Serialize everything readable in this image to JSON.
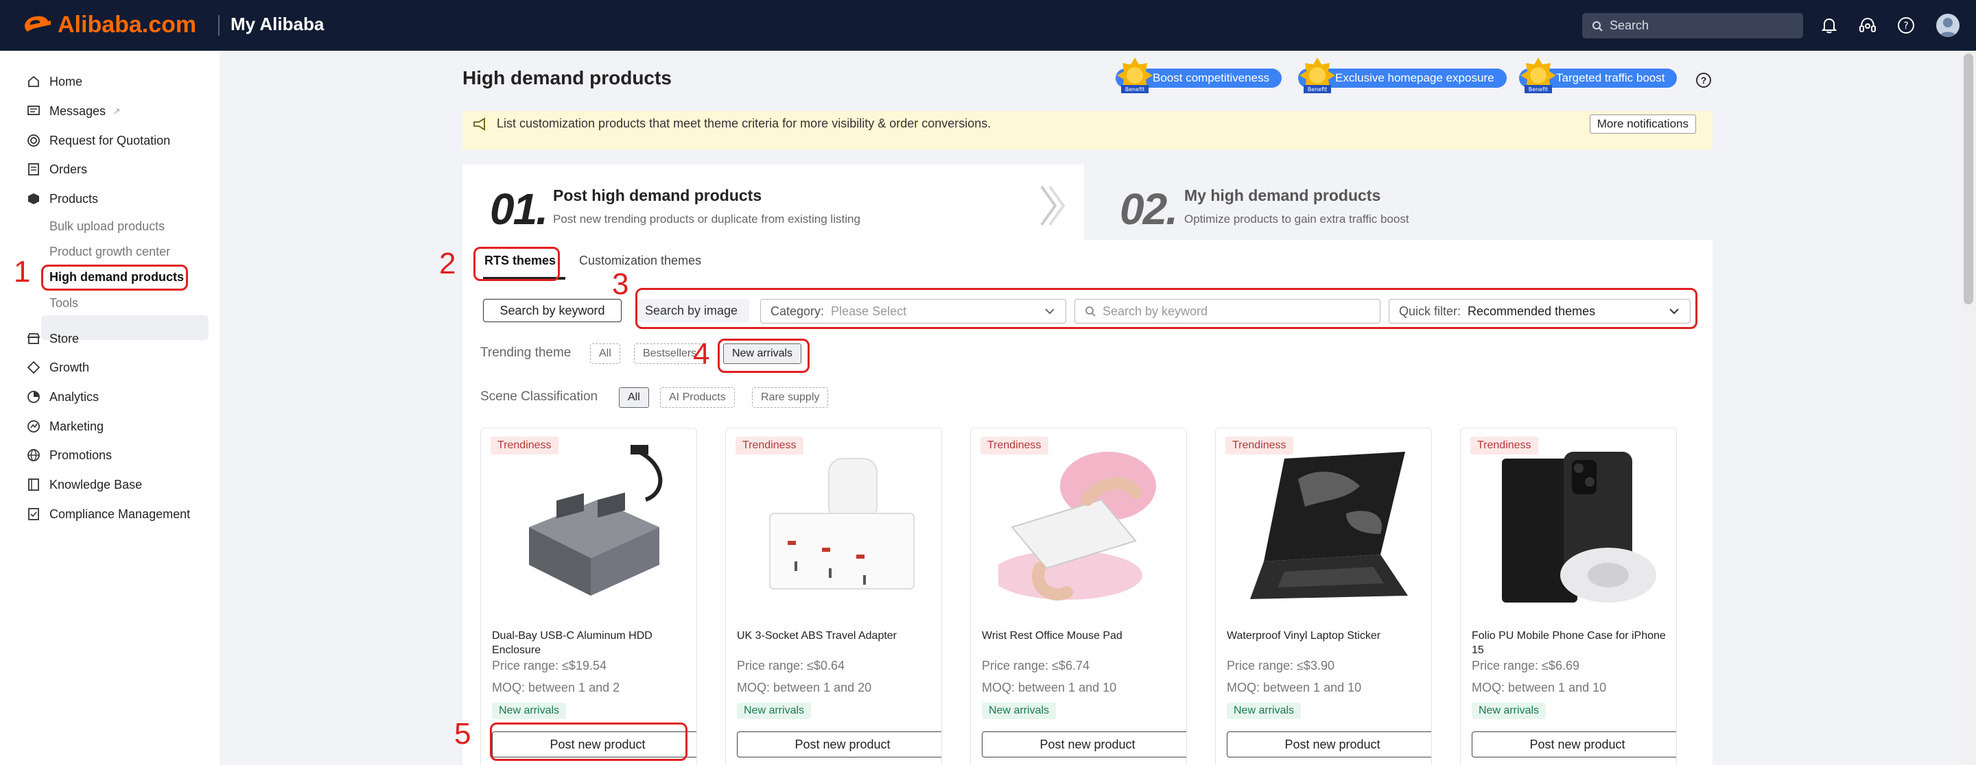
{
  "header": {
    "brand": "Alibaba.com",
    "section": "My Alibaba",
    "search_placeholder": "Search",
    "icons": [
      "bell-icon",
      "headset-icon",
      "help-icon",
      "avatar"
    ]
  },
  "sidebar": {
    "items": [
      {
        "label": "Home",
        "icon": "home-icon"
      },
      {
        "label": "Messages",
        "icon": "message-icon"
      },
      {
        "label": "Request for Quotation",
        "icon": "target-icon"
      },
      {
        "label": "Orders",
        "icon": "orders-icon"
      },
      {
        "label": "Products",
        "icon": "cube-icon"
      },
      {
        "label": "Store",
        "icon": "store-icon"
      },
      {
        "label": "Growth",
        "icon": "growth-icon"
      },
      {
        "label": "Analytics",
        "icon": "analytics-icon"
      },
      {
        "label": "Marketing",
        "icon": "marketing-icon"
      },
      {
        "label": "Promotions",
        "icon": "globe-icon"
      },
      {
        "label": "Knowledge Base",
        "icon": "book-icon"
      },
      {
        "label": "Compliance Management",
        "icon": "compliance-icon"
      }
    ],
    "products_sub": [
      "Bulk upload products",
      "Product growth center",
      "High demand products",
      "Tools"
    ],
    "active_sub": "High demand products"
  },
  "main": {
    "title": "High demand products",
    "benefits": [
      "Boost competitiveness",
      "Exclusive homepage exposure",
      "Targeted traffic boost"
    ],
    "benefit_medal_text": "Benefit",
    "notice": {
      "text": "List customization products that meet theme criteria for more visibility & order conversions.",
      "button": "More notifications"
    },
    "steps": [
      {
        "num": "01.",
        "title": "Post high demand products",
        "desc": "Post new trending products or duplicate from existing listing"
      },
      {
        "num": "02.",
        "title": "My high demand products",
        "desc": "Optimize products to gain extra traffic boost"
      }
    ],
    "tabs": [
      "RTS themes",
      "Customization themes"
    ],
    "search": {
      "by_keyword_btn": "Search by keyword",
      "by_image_btn": "Search by image",
      "category_label": "Category:",
      "category_value": "Please Select",
      "keyword_placeholder": "Search by keyword",
      "quick_filter_label": "Quick filter:",
      "quick_filter_value": "Recommended themes"
    },
    "trending": {
      "label": "Trending theme",
      "chips": [
        "All",
        "Bestsellers",
        "New arrivals"
      ],
      "selected": "New arrivals"
    },
    "scene": {
      "label": "Scene Classification",
      "chips": [
        "All",
        "AI Products",
        "Rare supply"
      ],
      "selected": "All"
    },
    "cards": [
      {
        "badge": "Trendiness",
        "name": "Dual-Bay USB-C Aluminum HDD Enclosure",
        "price": "Price range: ≤$19.54",
        "moq": "MOQ: between 1 and 2",
        "tag": "New arrivals",
        "button": "Post new product"
      },
      {
        "badge": "Trendiness",
        "name": "UK 3-Socket ABS Travel Adapter",
        "price": "Price range: ≤$0.64",
        "moq": "MOQ: between 1 and 20",
        "tag": "New arrivals",
        "button": "Post new product"
      },
      {
        "badge": "Trendiness",
        "name": "Wrist Rest Office Mouse Pad",
        "price": "Price range: ≤$6.74",
        "moq": "MOQ: between 1 and 10",
        "tag": "New arrivals",
        "button": "Post new product"
      },
      {
        "badge": "Trendiness",
        "name": "Waterproof Vinyl Laptop Sticker",
        "price": "Price range: ≤$3.90",
        "moq": "MOQ: between 1 and 10",
        "tag": "New arrivals",
        "button": "Post new product"
      },
      {
        "badge": "Trendiness",
        "name": "Folio PU Mobile Phone Case for iPhone 15",
        "price": "Price range: ≤$6.69",
        "moq": "MOQ: between 1 and 10",
        "tag": "New arrivals",
        "button": "Post new product"
      }
    ]
  },
  "annotations": [
    "1",
    "2",
    "3",
    "4",
    "5"
  ],
  "colors": {
    "topbar": "#111b33",
    "brand_orange": "#ff6a00",
    "benefit_blue": "#3b82f6",
    "annotation_red": "#e02020",
    "notice_bg": "#fff8d6"
  }
}
